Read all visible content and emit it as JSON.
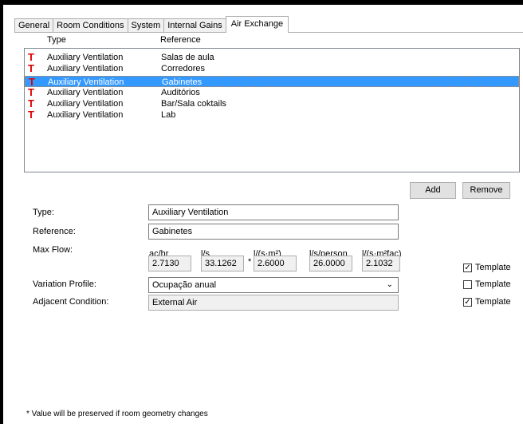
{
  "tabs": [
    {
      "label": "General"
    },
    {
      "label": "Room Conditions"
    },
    {
      "label": "System"
    },
    {
      "label": "Internal Gains"
    },
    {
      "label": "Air Exchange"
    }
  ],
  "list": {
    "col_type": "Type",
    "col_reference": "Reference",
    "rows": [
      {
        "marker": "T",
        "type": "Auxiliary Ventilation",
        "reference": "Salas de aula",
        "selected": false
      },
      {
        "marker": "T",
        "type": "Auxiliary Ventilation",
        "reference": "Corredores",
        "selected": false
      },
      {
        "marker": "T",
        "type": "Auxiliary Ventilation",
        "reference": "Gabinetes",
        "selected": true
      },
      {
        "marker": "T",
        "type": "Auxiliary Ventilation",
        "reference": "Auditórios",
        "selected": false
      },
      {
        "marker": "T",
        "type": "Auxiliary Ventilation",
        "reference": "Bar/Sala coktails",
        "selected": false
      },
      {
        "marker": "T",
        "type": "Auxiliary Ventilation",
        "reference": "Lab",
        "selected": false
      }
    ]
  },
  "buttons": {
    "add": "Add",
    "remove": "Remove"
  },
  "form": {
    "type_label": "Type:",
    "type_value": "Auxiliary Ventilation",
    "reference_label": "Reference:",
    "reference_value": "Gabinetes",
    "maxflow_label": "Max Flow:",
    "flow_headers": [
      "ac/hr",
      "l/s",
      "l/(s·m²)",
      "l/s/person",
      "l/(s·m²fac)"
    ],
    "flow_values": [
      "2.7130",
      "33.1262",
      "2.6000",
      "26.0000",
      "2.1032"
    ],
    "flow_asterisk": "*",
    "variation_label": "Variation Profile:",
    "variation_value": "Ocupação anual",
    "adjacent_label": "Adjacent Condition:",
    "adjacent_value": "External Air"
  },
  "templates": [
    {
      "label": "Template",
      "checked": true
    },
    {
      "label": "Template",
      "checked": false
    },
    {
      "label": "Template",
      "checked": true
    }
  ],
  "checkmark": "✓",
  "footnote": "* Value will be preserved if room geometry changes",
  "colors": {
    "selection": "#3399ff",
    "marker": "#e00000"
  }
}
